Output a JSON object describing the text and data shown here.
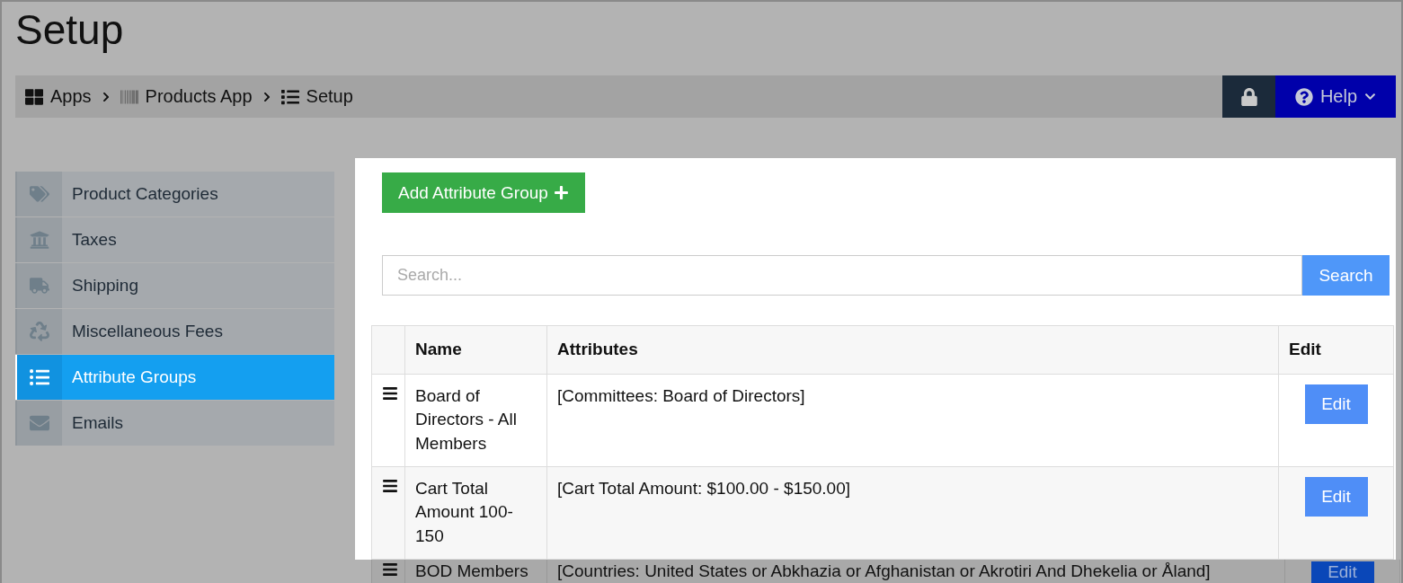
{
  "title": "Setup",
  "breadcrumb": [
    {
      "label": "Apps",
      "kind": "apps"
    },
    {
      "label": "Products App",
      "kind": "products"
    },
    {
      "label": "Setup",
      "kind": "setup"
    }
  ],
  "help": {
    "label": "Help"
  },
  "sidebar": {
    "items": [
      {
        "label": "Product Categories",
        "kind": "tags",
        "selected": false
      },
      {
        "label": "Taxes",
        "kind": "bank",
        "selected": false
      },
      {
        "label": "Shipping",
        "kind": "truck",
        "selected": false
      },
      {
        "label": "Miscellaneous Fees",
        "kind": "recycle",
        "selected": false
      },
      {
        "label": "Attribute Groups",
        "kind": "list",
        "selected": true
      },
      {
        "label": "Emails",
        "kind": "mail",
        "selected": false
      }
    ]
  },
  "add_button": {
    "label": "Add Attribute Group"
  },
  "search": {
    "placeholder": "Search...",
    "button": "Search"
  },
  "table": {
    "columns": [
      "Name",
      "Attributes",
      "Edit"
    ],
    "rows": [
      {
        "name": "Board of Directors - All Members",
        "attributes": "[Committees: Board of Directors]",
        "edit": "Edit",
        "spotlit": true
      },
      {
        "name": "Cart Total Amount 100-150",
        "attributes": "[Cart Total Amount: $100.00 - $150.00]",
        "edit": "Edit",
        "spotlit": true
      },
      {
        "name": "BOD Members",
        "attributes": "[Countries: United States or Abkhazia or Afghanistan or Akrotiri And Dhekelia or Åland]",
        "edit": "Edit",
        "spotlit": false
      }
    ]
  }
}
